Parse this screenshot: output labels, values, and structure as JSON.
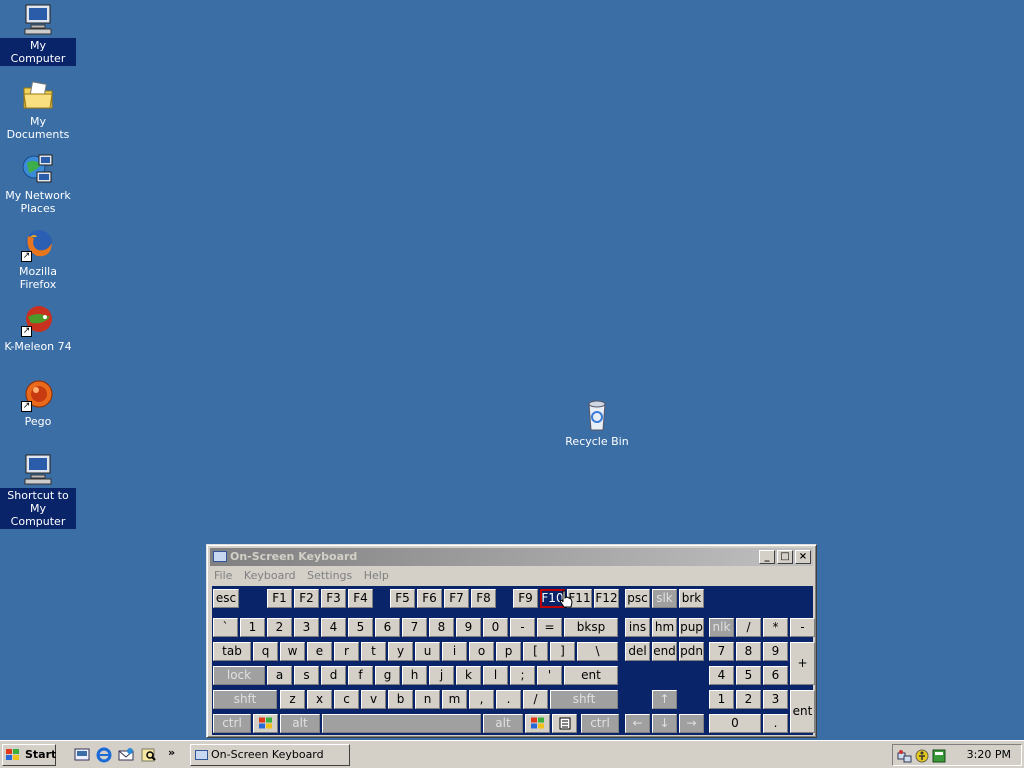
{
  "desktop": {
    "icons": [
      {
        "label": "My Computer",
        "icon": "my-computer-icon"
      },
      {
        "label": "My Documents",
        "icon": "folder-documents-icon"
      },
      {
        "label": "My Network Places",
        "icon": "network-places-icon"
      },
      {
        "label": "Mozilla Firefox",
        "icon": "firefox-icon"
      },
      {
        "label": "K-Meleon 74",
        "icon": "kmeleon-icon"
      },
      {
        "label": "Pego",
        "icon": "pego-icon"
      },
      {
        "label": "Shortcut to My Computer",
        "icon": "computer-shortcut-icon"
      },
      {
        "label": "Recycle Bin",
        "icon": "recycle-bin-icon"
      }
    ]
  },
  "osk": {
    "title": "On-Screen Keyboard",
    "menu": [
      "File",
      "Keyboard",
      "Settings",
      "Help"
    ],
    "rows": {
      "fn": [
        "esc",
        "F1",
        "F2",
        "F3",
        "F4",
        "F5",
        "F6",
        "F7",
        "F8",
        "F9",
        "F10",
        "F11",
        "F12",
        "psc",
        "slk",
        "brk"
      ],
      "num": [
        "`",
        "1",
        "2",
        "3",
        "4",
        "5",
        "6",
        "7",
        "8",
        "9",
        "0",
        "-",
        "=",
        "bksp",
        "ins",
        "hm",
        "pup",
        "nlk",
        "/",
        "*",
        "-"
      ],
      "top": [
        "tab",
        "q",
        "w",
        "e",
        "r",
        "t",
        "y",
        "u",
        "i",
        "o",
        "p",
        "[",
        "]",
        "\\",
        "del",
        "end",
        "pdn",
        "7",
        "8",
        "9",
        "+"
      ],
      "home": [
        "lock",
        "a",
        "s",
        "d",
        "f",
        "g",
        "h",
        "j",
        "k",
        "l",
        ";",
        "'",
        "ent",
        "4",
        "5",
        "6"
      ],
      "bottom": [
        "shft",
        "z",
        "x",
        "c",
        "v",
        "b",
        "n",
        "m",
        ",",
        ".",
        "/",
        "shft",
        "1",
        "2",
        "3",
        "ent"
      ],
      "space": [
        "ctrl",
        "alt",
        "alt",
        "ctrl",
        "0",
        "."
      ]
    },
    "highlighted_key": "F10"
  },
  "taskbar": {
    "start_label": "Start",
    "task_label": "On-Screen Keyboard",
    "clock": "3:20 PM"
  },
  "colors": {
    "desktop": "#3a6ea5",
    "keyboard_bg": "#0a246a",
    "key_face": "#d4d0c8"
  }
}
